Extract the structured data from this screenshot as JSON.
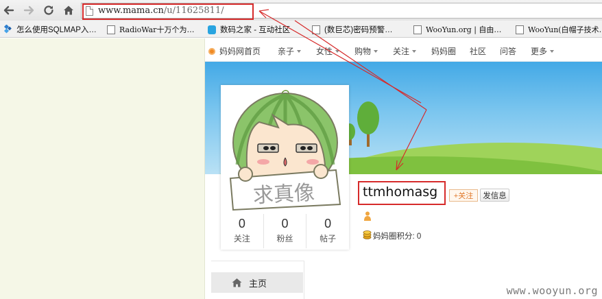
{
  "browser": {
    "url_host": "www.mama.cn",
    "url_path": "/u/11625811/",
    "bookmarks": [
      {
        "label": "怎么使用SQLMAP入…",
        "icon": "diamond-icon"
      },
      {
        "label": "RadioWar十万个为…",
        "icon": "page-icon"
      },
      {
        "label": "数码之家 - 互动社区",
        "icon": "app-icon"
      },
      {
        "label": "(数巨芯)密码预警…",
        "icon": "page-icon"
      },
      {
        "label": "WooYun.org | 自由…",
        "icon": "page-icon"
      },
      {
        "label": "WooYun(白帽子技术…",
        "icon": "page-icon"
      }
    ]
  },
  "site_nav": {
    "home": "妈妈网首页",
    "items": [
      {
        "label": "亲子",
        "dropdown": true
      },
      {
        "label": "女性",
        "dropdown": true
      },
      {
        "label": "购物",
        "dropdown": true
      },
      {
        "label": "关注",
        "dropdown": true
      },
      {
        "label": "妈妈圈",
        "dropdown": false
      },
      {
        "label": "社区",
        "dropdown": false
      },
      {
        "label": "问答",
        "dropdown": false
      },
      {
        "label": "更多",
        "dropdown": true
      }
    ]
  },
  "profile": {
    "avatar_caption": "求真像",
    "username": "ttmhomasg",
    "follow_label": "+关注",
    "message_label": "发信息",
    "points_label": "妈妈圈积分: 0",
    "stats": [
      {
        "value": "0",
        "label": "关注"
      },
      {
        "value": "0",
        "label": "粉丝"
      },
      {
        "value": "0",
        "label": "帖子"
      }
    ]
  },
  "side_menu": {
    "home_label": "主页"
  },
  "watermark": "www.wooyun.org",
  "colors": {
    "annotation_red": "#d62a2a",
    "accent_orange": "#e0782a",
    "sky_blue": "#43a9e6",
    "grass_green": "#7fc13f"
  }
}
